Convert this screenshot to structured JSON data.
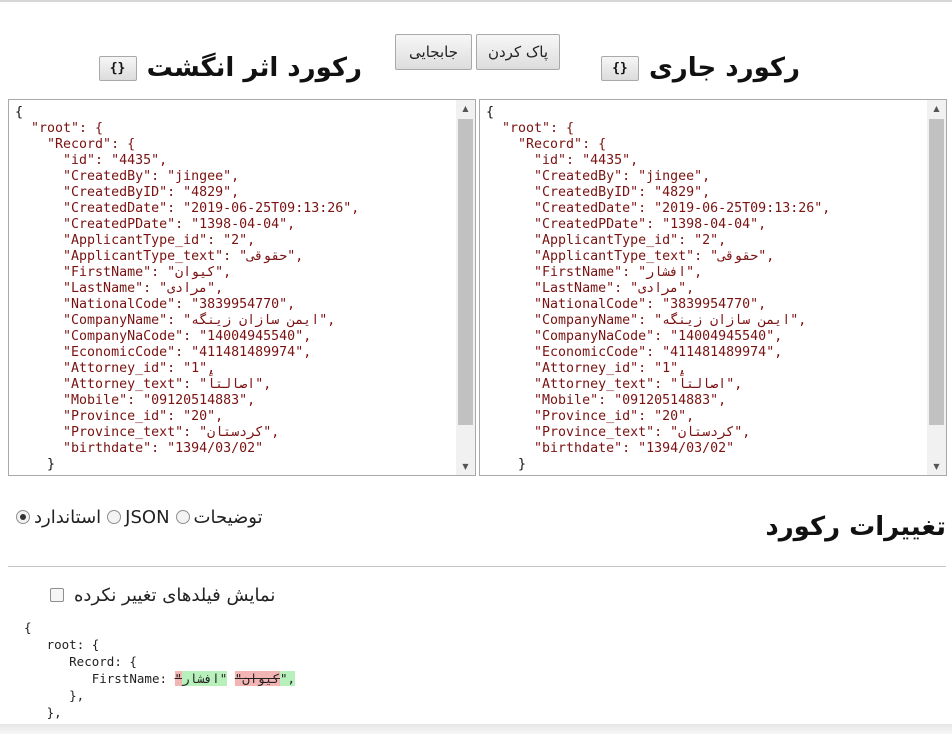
{
  "header": {
    "current_record_title": "رکورد جاری",
    "fingerprint_record_title": "رکورد اثر انگشت",
    "brace_button_label": "{}",
    "clear_button_label": "پاک کردن",
    "swap_button_label": "جابجایی"
  },
  "records": {
    "root_key": "root",
    "record_key": "Record",
    "fields": [
      {
        "key": "id",
        "left": "4435",
        "right": "4435"
      },
      {
        "key": "CreatedBy",
        "left": "jingee",
        "right": "jingee"
      },
      {
        "key": "CreatedByID",
        "left": "4829",
        "right": "4829"
      },
      {
        "key": "CreatedDate",
        "left": "2019-06-25T09:13:26",
        "right": "2019-06-25T09:13:26"
      },
      {
        "key": "CreatedPDate",
        "left": "1398-04-04",
        "right": "1398-04-04"
      },
      {
        "key": "ApplicantType_id",
        "left": "2",
        "right": "2"
      },
      {
        "key": "ApplicantType_text",
        "left": "حقوقی",
        "right": "حقوقی"
      },
      {
        "key": "FirstName",
        "left": "کیوان",
        "right": "افشار"
      },
      {
        "key": "LastName",
        "left": "مرادی",
        "right": "مرادی"
      },
      {
        "key": "NationalCode",
        "left": "3839954770",
        "right": "3839954770"
      },
      {
        "key": "CompanyName",
        "left": "ایمن سازان زینگه",
        "right": "ایمن سازان زینگه"
      },
      {
        "key": "CompanyNaCode",
        "left": "14004945540",
        "right": "14004945540"
      },
      {
        "key": "EconomicCode",
        "left": "411481489974",
        "right": "411481489974"
      },
      {
        "key": "Attorney_id",
        "left": "1",
        "right": "1"
      },
      {
        "key": "Attorney_text",
        "left": "اصالتاً",
        "right": "اصالتاً"
      },
      {
        "key": "Mobile",
        "left": "09120514883",
        "right": "09120514883"
      },
      {
        "key": "Province_id",
        "left": "20",
        "right": "20"
      },
      {
        "key": "Province_text",
        "left": "کردستان",
        "right": "کردستان"
      },
      {
        "key": "birthdate",
        "left": "1394/03/02",
        "right": "1394/03/02"
      }
    ]
  },
  "changes": {
    "title": "تغییرات رکورد",
    "formats": [
      {
        "label": "استاندارد",
        "checked": true
      },
      {
        "label": "JSON",
        "checked": false
      },
      {
        "label": "توضیحات",
        "checked": false
      }
    ],
    "show_unchanged_label": "نمایش فیلدهای تغییر نکرده",
    "show_unchanged_checked": false,
    "diff": {
      "root_key": "root",
      "record_key": "Record",
      "field_key": "FirstName",
      "old_value": "کیوان",
      "new_value": "افشار"
    },
    "deleted_color": "#f3b4b4",
    "inserted_color": "#b7f0bb"
  }
}
